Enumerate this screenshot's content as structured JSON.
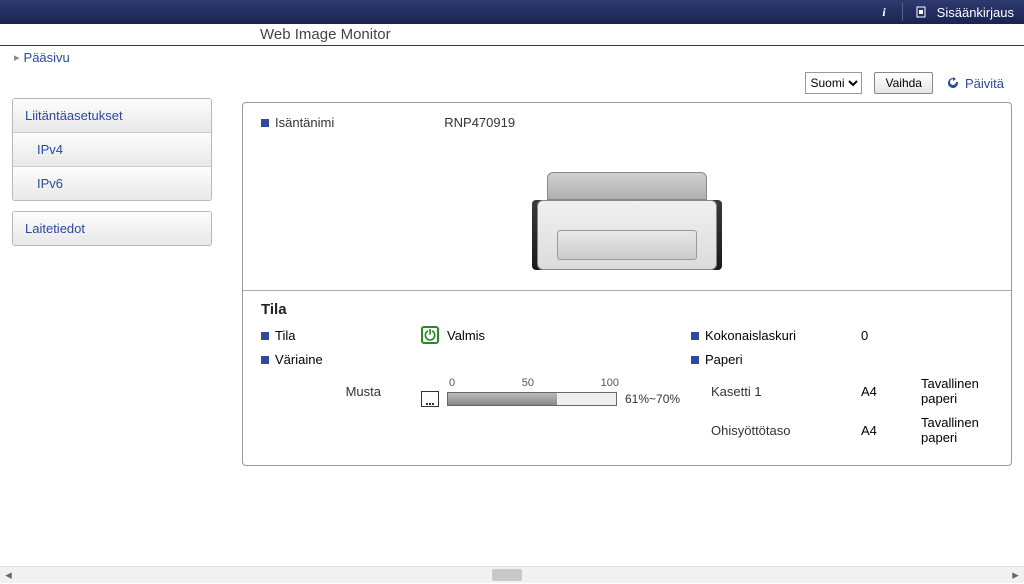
{
  "topbar": {
    "login_label": "Sisäänkirjaus"
  },
  "title": "Web Image Monitor",
  "breadcrumb": {
    "home": "Pääsivu"
  },
  "sidebar": {
    "group1": {
      "header": "Liitäntäasetukset",
      "items": [
        "IPv4",
        "IPv6"
      ]
    },
    "group2": {
      "header": "Laitetiedot"
    }
  },
  "controls": {
    "language_selected": "Suomi",
    "change_btn": "Vaihda",
    "refresh": "Päivitä"
  },
  "main": {
    "hostname_label": "Isäntänimi",
    "hostname_value": "RNP470919",
    "status_title": "Tila",
    "status_label": "Tila",
    "status_value": "Valmis",
    "toner_label": "Väriaine",
    "toner_color": "Musta",
    "toner_scale": {
      "a": "0",
      "b": "50",
      "c": "100"
    },
    "toner_percent": "61%~70%",
    "toner_fill_pct": 65,
    "counter_label": "Kokonaislaskuri",
    "counter_value": "0",
    "paper_label": "Paperi",
    "trays": [
      {
        "name": "Kasetti 1",
        "size": "A4",
        "type": "Tavallinen paperi"
      },
      {
        "name": "Ohisyöttötaso",
        "size": "A4",
        "type": "Tavallinen paperi"
      }
    ]
  }
}
